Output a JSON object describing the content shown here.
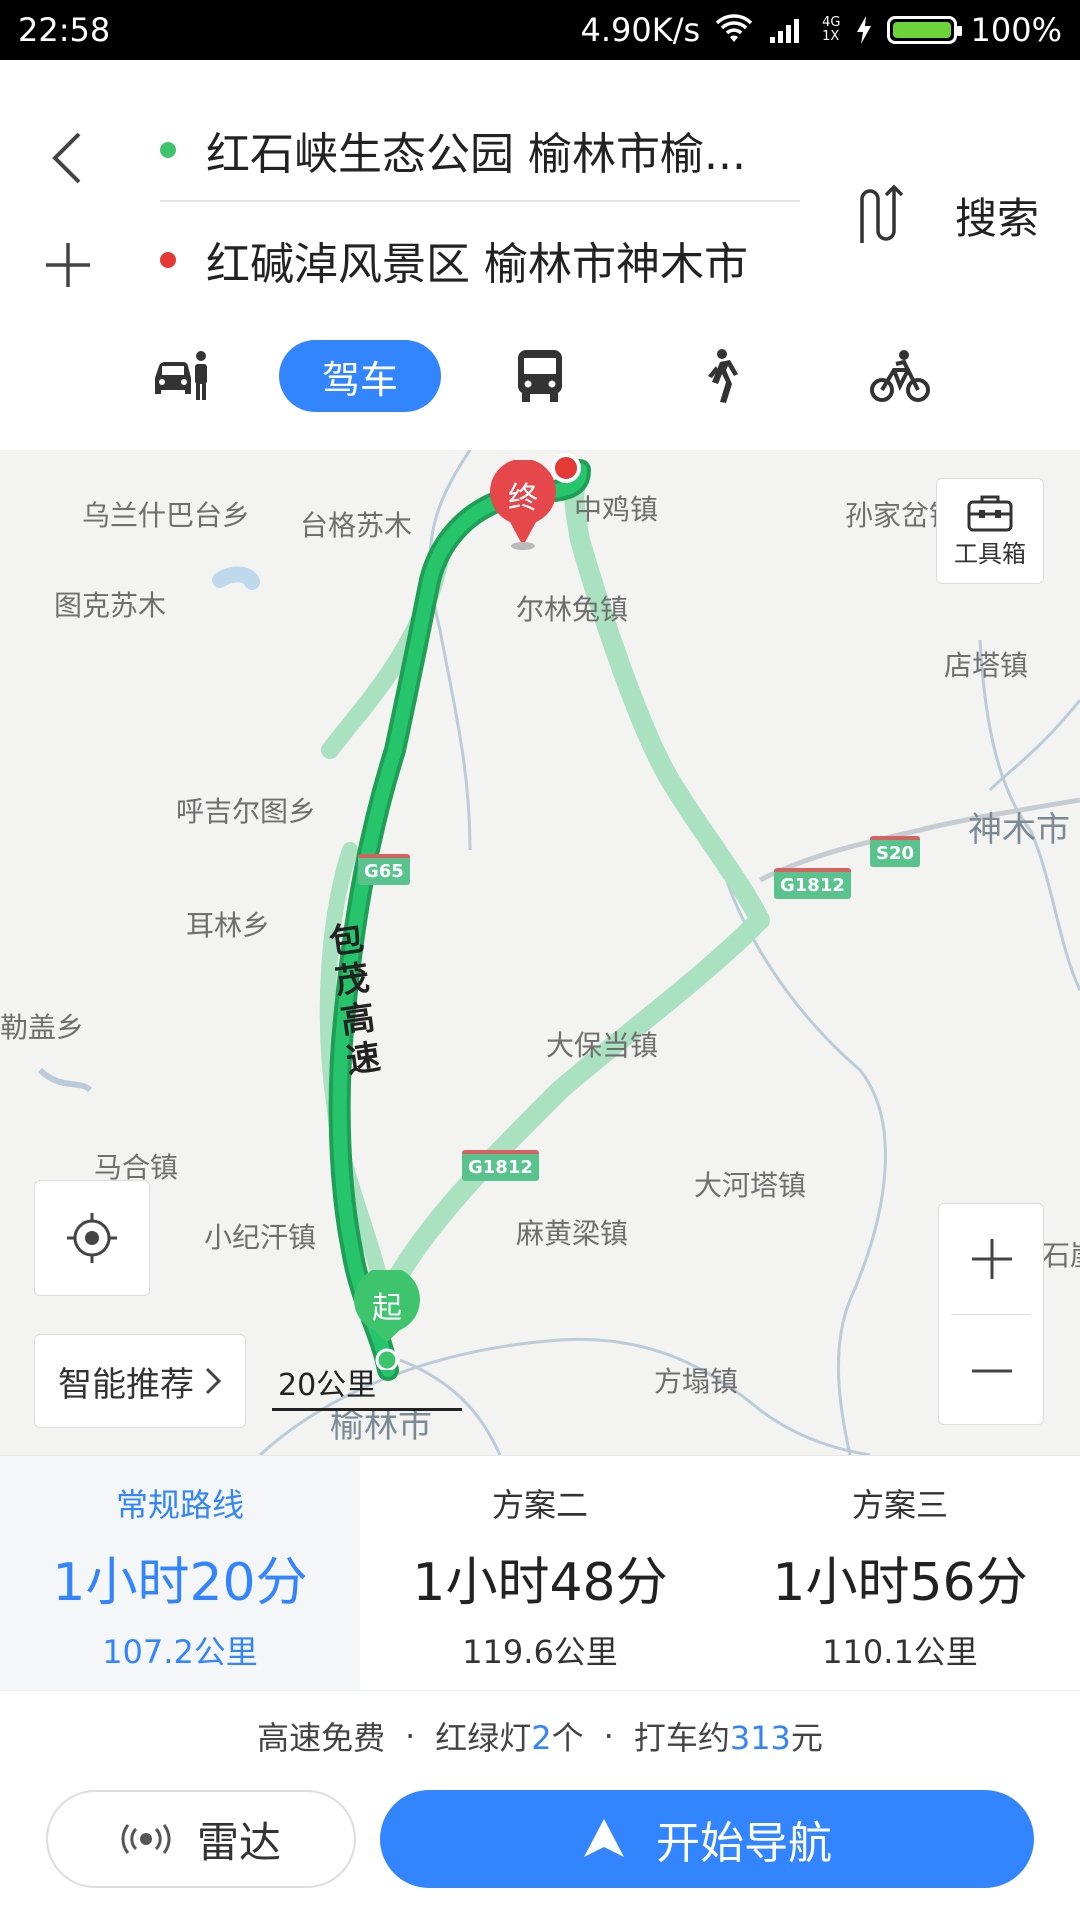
{
  "status_bar": {
    "time": "22:58",
    "network_speed": "4.90K/s",
    "signal_labels": [
      "4G",
      "1X"
    ],
    "battery": "100%"
  },
  "header": {
    "origin": "红石峡生态公园 榆林市榆...",
    "destination": "红碱淖风景区 榆林市神木市",
    "search_label": "搜索",
    "origin_dot_color": "#3ec46d",
    "destination_dot_color": "#e53935"
  },
  "modes": {
    "items": [
      {
        "name": "taxi",
        "icon": "taxi-icon"
      },
      {
        "name": "drive",
        "label": "驾车",
        "active": true
      },
      {
        "name": "bus",
        "icon": "bus-icon"
      },
      {
        "name": "walk",
        "icon": "walk-icon"
      },
      {
        "name": "bike",
        "icon": "bike-icon"
      }
    ]
  },
  "map": {
    "places": [
      "乌兰什巴台乡",
      "台格苏木",
      "中鸡镇",
      "孙家岔镇",
      "图克苏木",
      "尔林兔镇",
      "店塔镇",
      "呼吉尔图乡",
      "神木市",
      "耳林乡",
      "勒盖乡",
      "大保当镇",
      "马合镇",
      "大河塔镇",
      "小纪汗镇",
      "麻黄梁镇",
      "榆林市",
      "方塌镇",
      "石崖"
    ],
    "road_shields": [
      "G65",
      "G1812",
      "S20",
      "G1812"
    ],
    "route_name": "包茂高速",
    "route_name_chars": [
      "包",
      "茂",
      "高",
      "速"
    ],
    "start_pin": "起",
    "end_pin": "终",
    "toolbox_label": "工具箱",
    "smart_label": "智能推荐",
    "scale_label": "20公里",
    "route_color": "#1fbf6a",
    "alt_route_color": "#a9e1c1"
  },
  "plans": [
    {
      "name": "常规路线",
      "time": "1小时20分",
      "distance": "107.2公里",
      "active": true
    },
    {
      "name": "方案二",
      "time": "1小时48分",
      "distance": "119.6公里"
    },
    {
      "name": "方案三",
      "time": "1小时56分",
      "distance": "110.1公里"
    }
  ],
  "info": {
    "toll": "高速免费",
    "sep": "·",
    "lights_prefix": "红绿灯",
    "lights_count": "2",
    "lights_suffix": "个",
    "taxi_prefix": "打车约",
    "taxi_price": "313",
    "taxi_suffix": "元"
  },
  "actions": {
    "radar_label": "雷达",
    "navigate_label": "开始导航"
  },
  "colors": {
    "accent": "#3385ff"
  }
}
